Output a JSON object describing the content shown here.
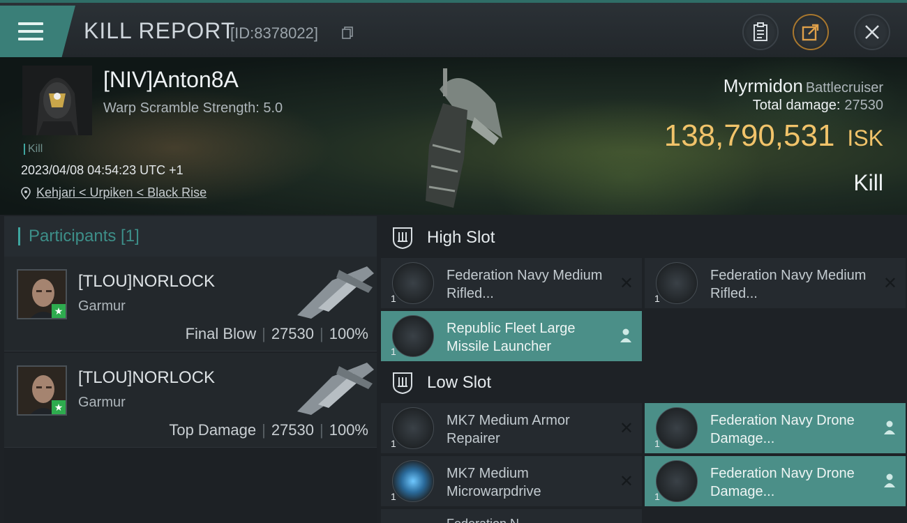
{
  "header": {
    "title": "KILL REPORT",
    "report_id": "[ID:8378022]",
    "icons": {
      "menu": "hamburger-menu-icon",
      "copy": "copy-icon",
      "clipboard": "clipboard-icon",
      "share": "share-icon",
      "close": "close-icon"
    }
  },
  "victim": {
    "name": "[NIV]Anton8A",
    "warp_scramble": "Warp Scramble Strength: 5.0",
    "tag": "Kill",
    "timestamp": "2023/04/08 04:54:23 UTC +1",
    "location": "Kehjari < Urpiken < Black Rise",
    "ship_name": "Myrmidon",
    "ship_class": "Battlecruiser",
    "total_damage_label": "Total damage:",
    "total_damage": "27530",
    "isk_value": "138,790,531",
    "isk_unit": "ISK",
    "result": "Kill"
  },
  "participants": {
    "header": "Participants [1]",
    "rows": [
      {
        "name": "[TLOU]NORLOCK",
        "ship": "Garmur",
        "role": "Final Blow",
        "damage": "27530",
        "percent": "100%"
      },
      {
        "name": "[TLOU]NORLOCK",
        "ship": "Garmur",
        "role": "Top Damage",
        "damage": "27530",
        "percent": "100%"
      }
    ]
  },
  "slots": {
    "high": {
      "label": "High Slot",
      "items": [
        {
          "name": "Federation Navy Medium Rifled...",
          "qty": "1",
          "active": false
        },
        {
          "name": "Federation Navy Medium Rifled...",
          "qty": "1",
          "active": false
        },
        {
          "name": "Republic Fleet Large Missile Launcher",
          "qty": "1",
          "active": true
        }
      ]
    },
    "low": {
      "label": "Low Slot",
      "items": [
        {
          "name": "MK7 Medium Armor Repairer",
          "qty": "1",
          "active": false
        },
        {
          "name": "Federation Navy Drone Damage...",
          "qty": "1",
          "active": true
        },
        {
          "name": "MK7 Medium Microwarpdrive",
          "qty": "1",
          "active": false
        },
        {
          "name": "Federation Navy Drone Damage...",
          "qty": "1",
          "active": true
        }
      ]
    },
    "partial_next": "Federation N"
  },
  "colors": {
    "accent": "#3fa6a0",
    "isk": "#f1c36a",
    "active_item": "#4b8f88"
  }
}
